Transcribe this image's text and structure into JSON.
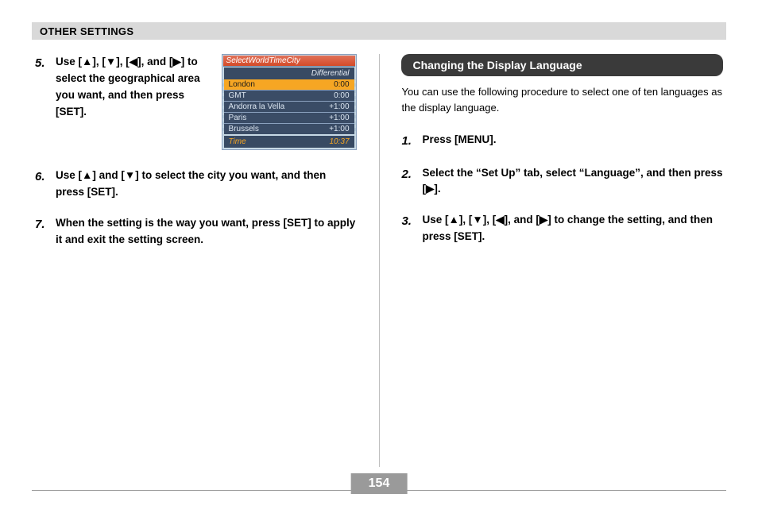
{
  "header": {
    "title": "OTHER SETTINGS"
  },
  "symbols": {
    "up": "▲",
    "down": "▼",
    "left": "◀",
    "right": "▶"
  },
  "left": {
    "steps": [
      {
        "num": "5.",
        "text": "Use [▲], [▼], [◀], and [▶] to select the geographical area you want, and then press [SET]."
      },
      {
        "num": "6.",
        "text": "Use [▲] and [▼] to select the city you want, and then press [SET]."
      },
      {
        "num": "7.",
        "text": "When the setting is the way you want, press [SET] to apply it and exit the setting screen."
      }
    ]
  },
  "screenshot": {
    "title": "SelectWorldTimeCity",
    "subtitle": "Differential",
    "rows": [
      {
        "city": "London",
        "diff": "0:00",
        "highlight": true
      },
      {
        "city": "GMT",
        "diff": "0:00",
        "highlight": false
      },
      {
        "city": "Andorra la Vella",
        "diff": "+1:00",
        "highlight": false
      },
      {
        "city": "Paris",
        "diff": "+1:00",
        "highlight": false
      },
      {
        "city": "Brussels",
        "diff": "+1:00",
        "highlight": false
      }
    ],
    "footer_label": "Time",
    "footer_value": "10:37"
  },
  "right": {
    "section_title": "Changing the Display Language",
    "intro": "You can use the following procedure to select one of ten languages as the display language.",
    "steps": [
      {
        "num": "1.",
        "text": "Press [MENU]."
      },
      {
        "num": "2.",
        "text": "Select the “Set Up” tab, select “Language”, and then press [▶]."
      },
      {
        "num": "3.",
        "text": "Use [▲], [▼], [◀], and [▶] to change the setting, and then press [SET]."
      }
    ]
  },
  "page_number": "154"
}
